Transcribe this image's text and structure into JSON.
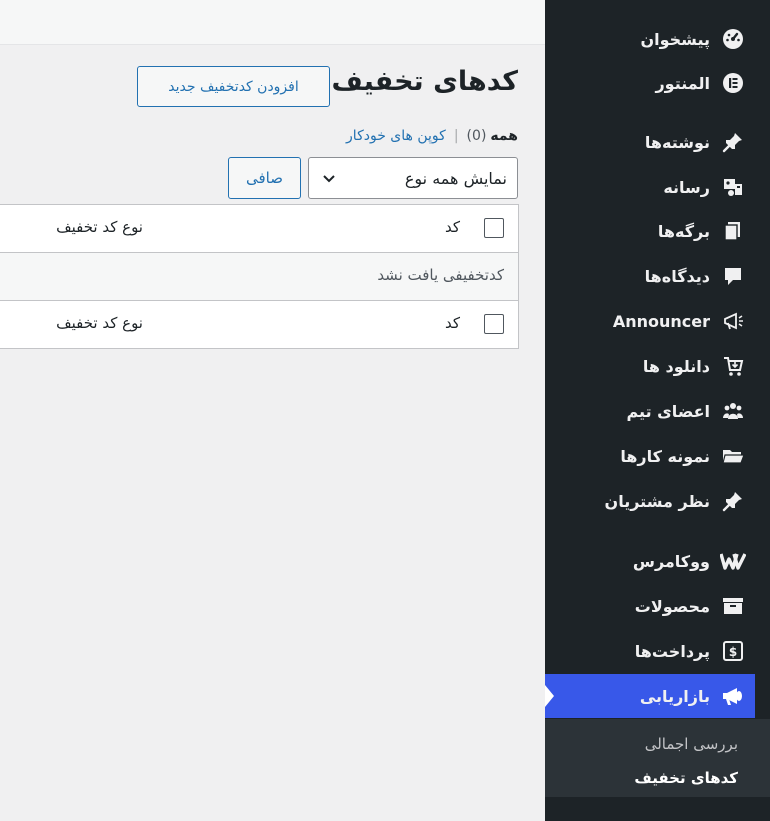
{
  "sidebar": {
    "items": [
      {
        "label": "پیشخوان",
        "icon": "dashboard-icon"
      },
      {
        "label": "المنتور",
        "icon": "elementor-icon"
      },
      {
        "label": "نوشته‌ها",
        "icon": "pin-icon"
      },
      {
        "label": "رسانه",
        "icon": "media-icon"
      },
      {
        "label": "برگه‌ها",
        "icon": "pages-icon"
      },
      {
        "label": "دیدگاه‌ها",
        "icon": "comments-icon"
      },
      {
        "label": "Announcer",
        "icon": "megaphone-icon"
      },
      {
        "label": "دانلود ها",
        "icon": "download-cart-icon"
      },
      {
        "label": "اعضای تیم",
        "icon": "team-icon"
      },
      {
        "label": "نمونه کارها",
        "icon": "portfolio-folder-icon"
      },
      {
        "label": "نظر مشتریان",
        "icon": "pin-icon"
      },
      {
        "label": "ووکامرس",
        "icon": "woocommerce-icon"
      },
      {
        "label": "محصولات",
        "icon": "products-box-icon"
      },
      {
        "label": "پرداخت‌ها",
        "icon": "payments-icon"
      },
      {
        "label": "بازاریابی",
        "icon": "marketing-megaphone-icon"
      }
    ],
    "submenu": [
      {
        "label": "بررسی اجمالی"
      },
      {
        "label": "کدهای تخفیف"
      }
    ]
  },
  "main": {
    "title": "کدهای تخفیف",
    "add_button": "افزودن کدتخفیف جدید",
    "views": {
      "all_label": "همه",
      "all_count": "(0)",
      "separator": "|",
      "auto_coupons": "کوپن های خودکار"
    },
    "type_filter": "نمایش همه نوع",
    "filter_button": "صافی",
    "table": {
      "col_code": "کد",
      "col_type": "نوع کد تخفیف",
      "empty_message": "کدتخفیفی یافت نشد"
    }
  },
  "colors": {
    "sidebar_bg": "#1d2327",
    "active_bg": "#3858e9",
    "link": "#2271b1"
  }
}
